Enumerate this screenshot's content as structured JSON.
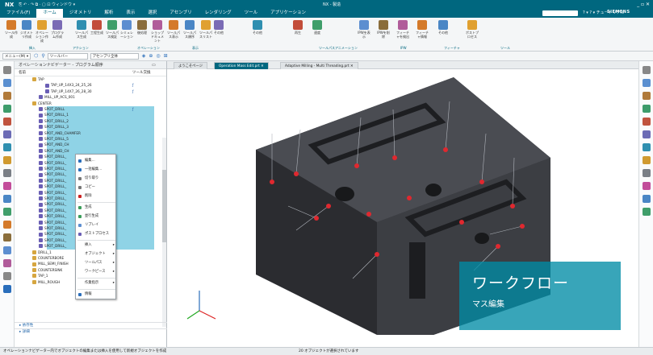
{
  "titlebar": {
    "logo": "NX",
    "quick_access": "⎘ ↶ · ↷ ⧉ · ▢ ⊡ ウィンドウ ▾",
    "title": "NX - 製造",
    "window_controls": "_ ▫ ✕"
  },
  "menubar": {
    "items": [
      "ファイル(F)",
      "ホーム",
      "ジオメトリ",
      "解析",
      "表示",
      "選択",
      "アセンブリ",
      "レンダリング",
      "ツール",
      "アプリケーション"
    ],
    "active": "ホーム",
    "brand": "SIEMENS",
    "help": "? ▾ ? ▾ チュートリアル"
  },
  "ribbon": {
    "buttons": [
      "ツール作成",
      "ジオメトリ作成",
      "オペレーション作成",
      "プログラム作成",
      "ツールパス生成",
      "工程生成",
      "ツールパス検証",
      "シミュレーション",
      "後処理",
      "ショップドキュメント",
      "ツールパス表示",
      "ツールパス順序",
      "ツールパスリスト",
      "その他",
      "その他",
      "再生",
      "速度",
      "IPWを表示",
      "IPWを削除",
      "フィーチャを検出",
      "フィーチャ情報",
      "その他",
      "ポストプロセス"
    ],
    "groups": [
      "挿入",
      "アクション",
      "オペレーション",
      "表示",
      "ツールパスアニメーション",
      "IPW",
      "フィーチャ",
      "ツール"
    ]
  },
  "commandbar": {
    "menu": "メニュー(M) ▾",
    "filter": "ツールバー",
    "scope": "アセンブリ全体"
  },
  "navigator": {
    "title": "オペレーションナビゲーター - プログラム順序",
    "col_name": "名前",
    "col_tool": "ツール交換",
    "bottom_links": [
      "▸ 依存性",
      "▸ 詳細"
    ]
  },
  "tree_rows": [
    {
      "indent": 0,
      "text": "TAP",
      "hl": false,
      "tool": ""
    },
    {
      "indent": 2,
      "text": "TAP_UP_14X3_24_25_26",
      "hl": false,
      "tool": "ƒ"
    },
    {
      "indent": 2,
      "text": "TAP_UP_14X7_26_28_30",
      "hl": false,
      "tool": "ƒ"
    },
    {
      "indent": 1,
      "text": "MILL_UP_ACS_001",
      "hl": false,
      "tool": ""
    },
    {
      "indent": 0,
      "text": "CENTER",
      "hl": false,
      "tool": ""
    },
    {
      "indent": 1,
      "text": "SPOT_DRILL",
      "hl": true,
      "tool": "ƒ"
    },
    {
      "indent": 1,
      "text": "SPOT_DRILL_1",
      "hl": true,
      "tool": ""
    },
    {
      "indent": 1,
      "text": "SPOT_DRILL_2",
      "hl": true,
      "tool": ""
    },
    {
      "indent": 1,
      "text": "SPOT_DRILL_3",
      "hl": true,
      "tool": ""
    },
    {
      "indent": 1,
      "text": "SPOT_AND_CHAMFER",
      "hl": true,
      "tool": ""
    },
    {
      "indent": 1,
      "text": "SPOT_DRILL_5",
      "hl": true,
      "tool": ""
    },
    {
      "indent": 1,
      "text": "SPOT_AND_CH",
      "hl": true,
      "tool": ""
    },
    {
      "indent": 1,
      "text": "SPOT_AND_CH",
      "hl": true,
      "tool": ""
    },
    {
      "indent": 1,
      "text": "SPOT_DRILL_",
      "hl": true,
      "tool": ""
    },
    {
      "indent": 1,
      "text": "SPOT_DRILL_",
      "hl": true,
      "tool": ""
    },
    {
      "indent": 1,
      "text": "SPOT_DRILL_",
      "hl": true,
      "tool": ""
    },
    {
      "indent": 1,
      "text": "SPOT_DRILL_",
      "hl": true,
      "tool": ""
    },
    {
      "indent": 1,
      "text": "SPOT_DRILL_",
      "hl": true,
      "tool": ""
    },
    {
      "indent": 1,
      "text": "SPOT_DRILL_",
      "hl": true,
      "tool": ""
    },
    {
      "indent": 1,
      "text": "SPOT_DRILL_",
      "hl": true,
      "tool": ""
    },
    {
      "indent": 1,
      "text": "SPOT_DRILL_",
      "hl": true,
      "tool": ""
    },
    {
      "indent": 1,
      "text": "SPOT_DRILL_",
      "hl": true,
      "tool": ""
    },
    {
      "indent": 1,
      "text": "SPOT_DRILL_",
      "hl": true,
      "tool": ""
    },
    {
      "indent": 1,
      "text": "SPOT_DRILL_",
      "hl": true,
      "tool": ""
    },
    {
      "indent": 1,
      "text": "SPOT_DRILL_",
      "hl": true,
      "tool": ""
    },
    {
      "indent": 1,
      "text": "SPOT_DRILL_",
      "hl": true,
      "tool": ""
    },
    {
      "indent": 1,
      "text": "SPOT_DRILL_",
      "hl": true,
      "tool": ""
    },
    {
      "indent": 1,
      "text": "SPOT_DRILL_",
      "hl": true,
      "tool": ""
    },
    {
      "indent": 1,
      "text": "SPOT_DRILL_",
      "hl": true,
      "tool": ""
    },
    {
      "indent": 0,
      "text": "DRILL_1",
      "hl": false,
      "tool": ""
    },
    {
      "indent": 0,
      "text": "COUNTERBORE",
      "hl": false,
      "tool": ""
    },
    {
      "indent": 0,
      "text": "MILL_SEMI_FINISH",
      "hl": false,
      "tool": ""
    },
    {
      "indent": 0,
      "text": "COUNTERSINK",
      "hl": false,
      "tool": ""
    },
    {
      "indent": 0,
      "text": "TAP_1",
      "hl": false,
      "tool": ""
    },
    {
      "indent": 0,
      "text": "MILL_ROUGH",
      "hl": false,
      "tool": ""
    }
  ],
  "context_menu": [
    {
      "label": "編集...",
      "arrow": ""
    },
    {
      "label": "一括編集...",
      "arrow": ""
    },
    {
      "label": "切り取り",
      "arrow": ""
    },
    {
      "label": "コピー",
      "arrow": ""
    },
    {
      "label": "削除",
      "arrow": ""
    },
    {
      "label": "生成",
      "arrow": ""
    },
    {
      "label": "並行生成",
      "arrow": ""
    },
    {
      "label": "リプレイ",
      "arrow": ""
    },
    {
      "label": "ポストプロセス",
      "arrow": ""
    },
    {
      "label": "挿入",
      "arrow": "▸"
    },
    {
      "label": "オブジェクト",
      "arrow": "▸"
    },
    {
      "label": "ツールパス",
      "arrow": "▸"
    },
    {
      "label": "ワークピース",
      "arrow": "▸"
    },
    {
      "label": "作業指示",
      "arrow": "▸"
    },
    {
      "label": "情報",
      "arrow": ""
    }
  ],
  "tabs": [
    "ようこそページ",
    "Operation Mass Edit.prt ✕",
    "Adaptive Milling - Multi Threading.prt ✕"
  ],
  "overlay": {
    "title": "ワークフロー",
    "subtitle": "マス編集"
  },
  "status": {
    "left": "オペレーションナビゲーター内でオブジェクトの編集または挿入を使用して新規オブジェクトを作成",
    "right": "20 オブジェクトが選択されています"
  },
  "colors": {
    "brand": "#00677f",
    "highlight": "#8fd3e6",
    "overlay": "#008ca5",
    "model": "#2e2f33"
  }
}
